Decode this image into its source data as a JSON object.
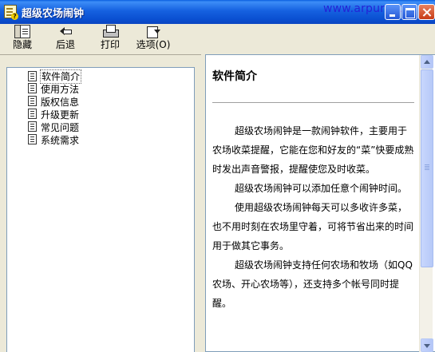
{
  "window": {
    "title": "超级农场闹钟",
    "watermark": "www.arpun.com"
  },
  "toolbar": {
    "hide_label": "隐藏",
    "back_label": "后退",
    "print_label": "打印",
    "options_label": "选项(O)"
  },
  "tree": {
    "items": [
      {
        "label": "软件简介",
        "selected": true
      },
      {
        "label": "使用方法"
      },
      {
        "label": "版权信息"
      },
      {
        "label": "升级更新"
      },
      {
        "label": "常见问题"
      },
      {
        "label": "系统需求"
      }
    ]
  },
  "content": {
    "title": "软件简介",
    "paragraphs": [
      "超级农场闹钟是一款闹钟软件，主要用于农场收菜提醒，它能在您和好友的“菜”快要成熟时发出声音警报，提醒使您及时收菜。",
      "超级农场闹钟可以添加任意个闹钟时间。",
      "使用超级农场闹钟每天可以多收许多菜，也不用时刻在农场里守着，可将节省出来的时间用于做其它事务。",
      "超级农场闹钟支持任何农场和牧场（如QQ农场、开心农场等），还支持多个帐号同时提醒。"
    ]
  },
  "colors": {
    "titlebar": "#0a4fd1",
    "watermark": "#2323d6",
    "window_bg": "#ece9d8"
  }
}
